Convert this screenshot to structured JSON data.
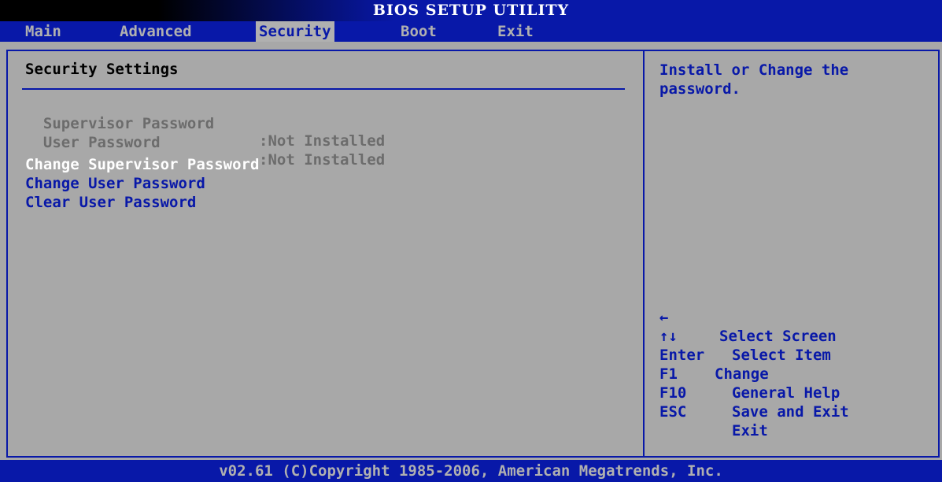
{
  "title": "BIOS SETUP UTILITY",
  "menu": [
    {
      "label": "Main"
    },
    {
      "label": "Advanced"
    },
    {
      "label": "Security"
    },
    {
      "label": "Boot"
    },
    {
      "label": "Exit"
    }
  ],
  "active_menu": "Security",
  "section_title": "Security Settings",
  "status": [
    {
      "label": "Supervisor Password",
      "value": ":Not Installed"
    },
    {
      "label": "User Password",
      "value": ":Not Installed"
    }
  ],
  "items": [
    {
      "label": "Change Supervisor Password",
      "selected": true
    },
    {
      "label": "Change User Password",
      "selected": false
    },
    {
      "label": "Clear User Password",
      "selected": false
    }
  ],
  "help_text": "Install or Change the password.",
  "keys": [
    {
      "key": "←",
      "desc": "Select Screen"
    },
    {
      "key": "↑↓",
      "desc": "Select Item"
    },
    {
      "key": "Enter",
      "desc": "Change"
    },
    {
      "key": "F1",
      "desc": "General Help"
    },
    {
      "key": "F10",
      "desc": "Save and Exit"
    },
    {
      "key": "ESC",
      "desc": "Exit"
    }
  ],
  "footer": "v02.61 (C)Copyright 1985-2006, American Megatrends, Inc.",
  "colors": {
    "blue": "#0818a8",
    "panel": "#a8a8a8",
    "highlight": "#ffffff"
  }
}
